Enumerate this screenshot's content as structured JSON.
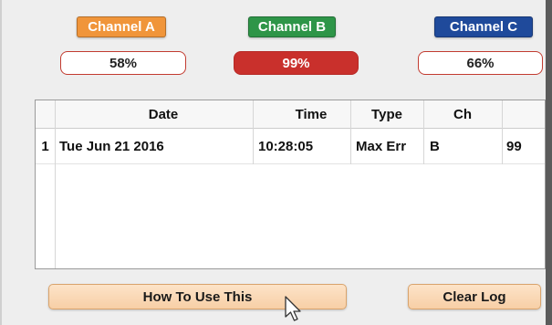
{
  "channels": {
    "a": {
      "label": "Channel A",
      "value": "58%",
      "color": "#f0953a"
    },
    "b": {
      "label": "Channel B",
      "value": "99%",
      "color": "#2e9548",
      "alert_color": "#c9302c"
    },
    "c": {
      "label": "Channel C",
      "value": "66%",
      "color": "#1f4a9b"
    }
  },
  "log_table": {
    "columns": [
      "Date",
      "Time",
      "Type",
      "Ch",
      ""
    ],
    "rows": [
      {
        "index": "1",
        "date": "Tue Jun 21 2016",
        "time": "10:28:05",
        "type": "Max Err",
        "ch": "B",
        "value": "99"
      }
    ]
  },
  "buttons": {
    "how_to_use": "How To Use This",
    "clear_log": "Clear Log"
  },
  "icons": {
    "cursor": "mouse-pointer-icon"
  }
}
